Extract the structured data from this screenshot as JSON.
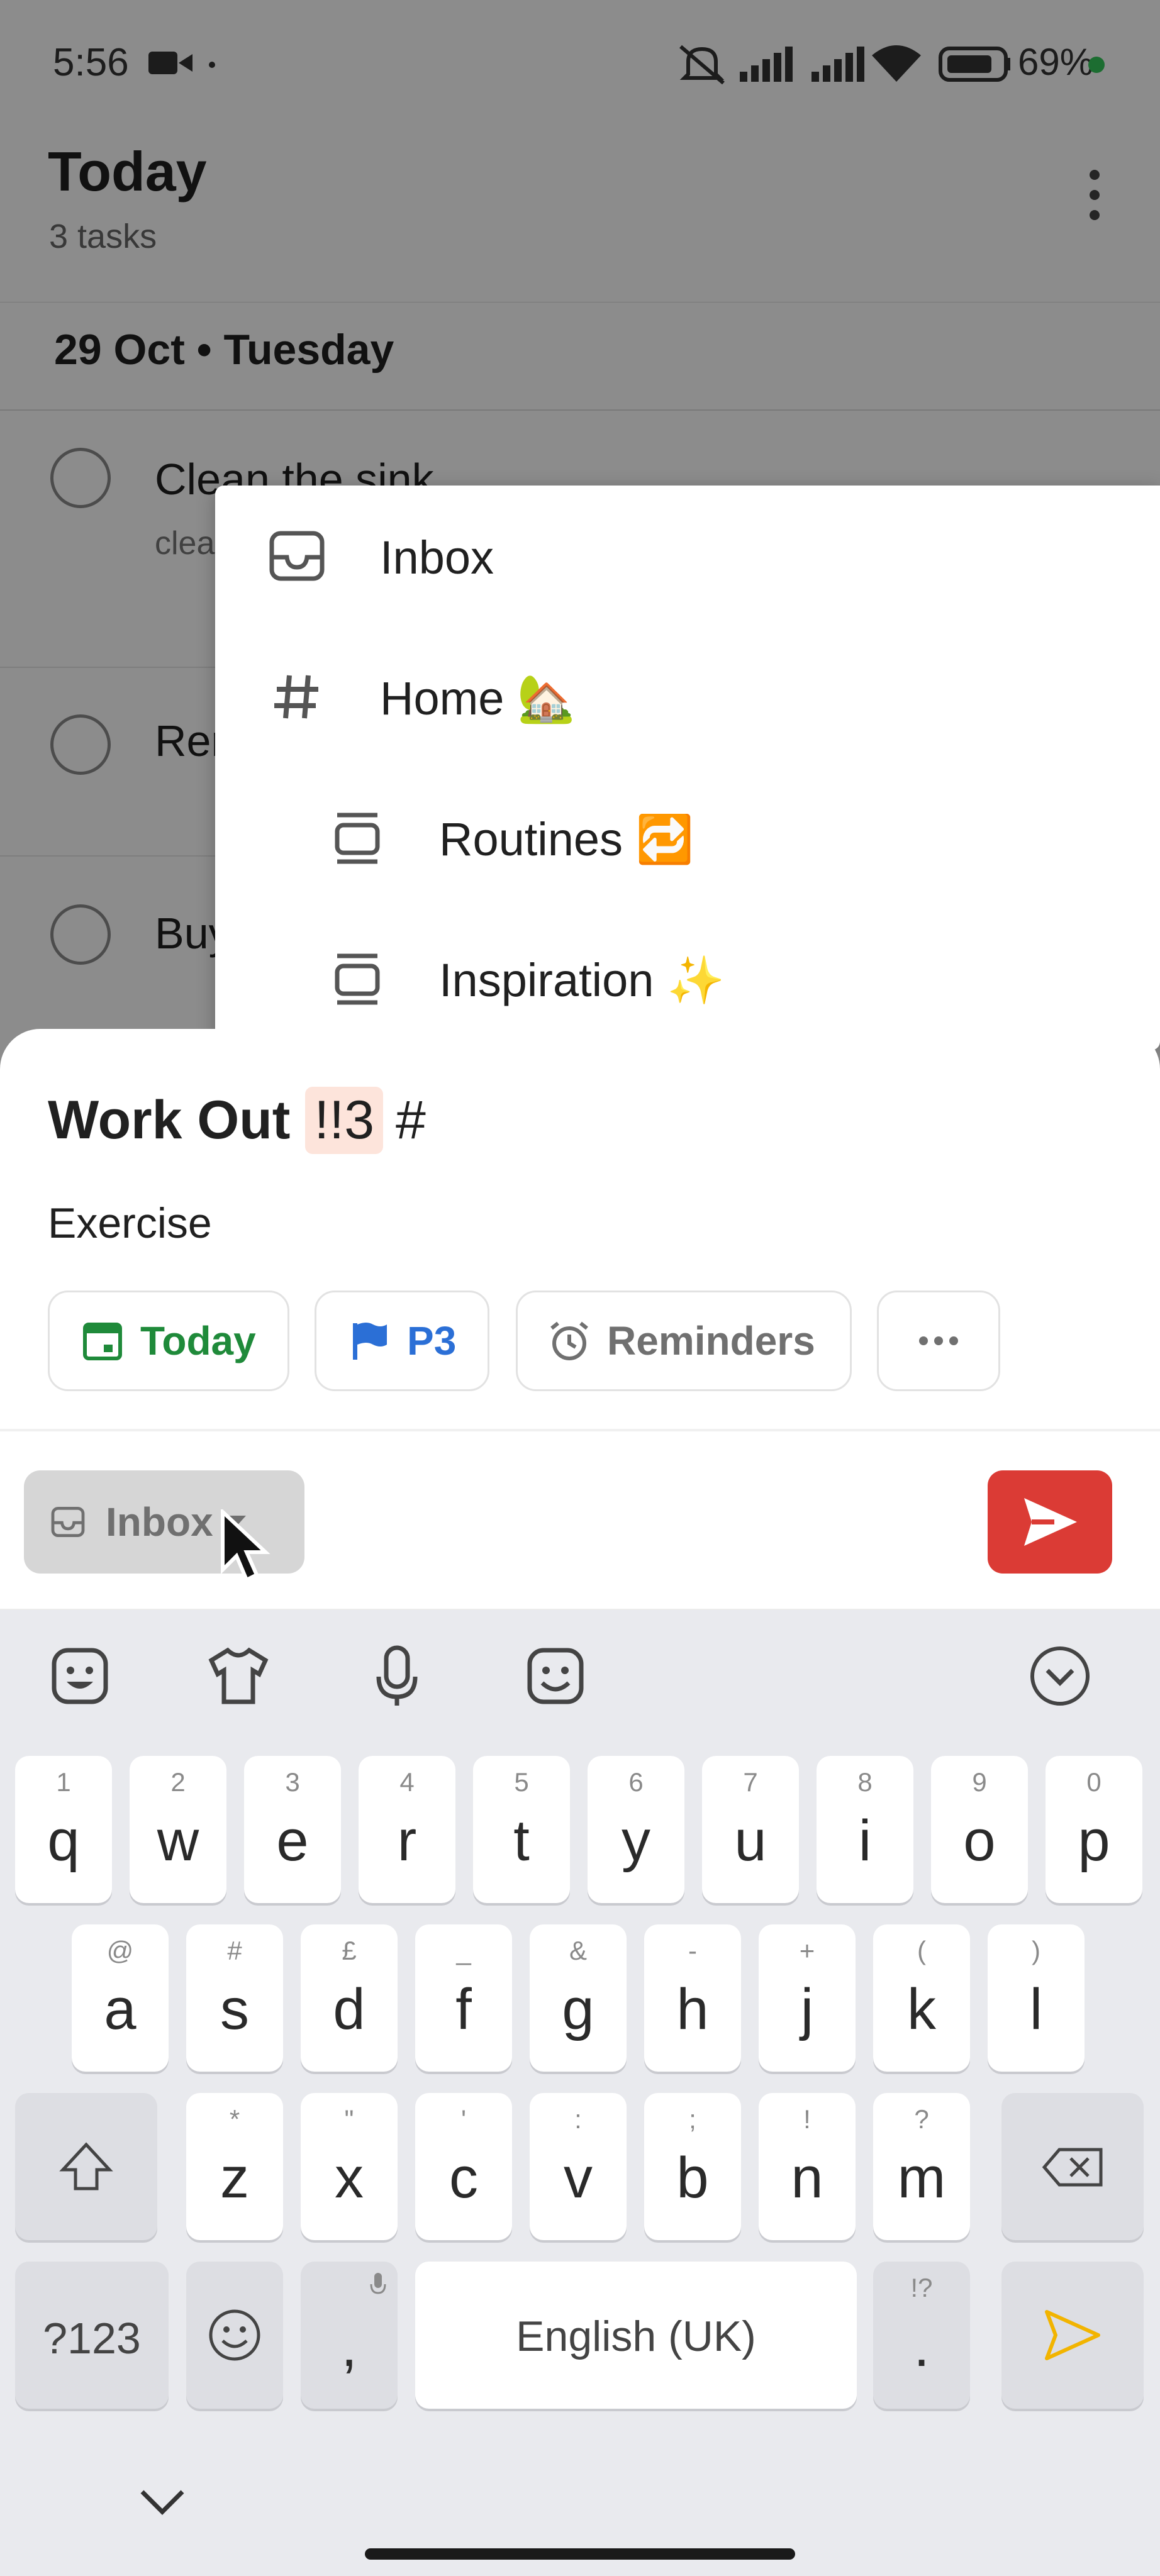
{
  "status_bar": {
    "time": "5:56",
    "battery": "69%"
  },
  "header": {
    "title": "Today",
    "subtitle": "3 tasks"
  },
  "date_section": {
    "label": "29 Oct • Tuesday"
  },
  "tasks": [
    {
      "title": "Clean the sink",
      "description": "clea"
    },
    {
      "title": "Rer"
    },
    {
      "title": "Buy"
    }
  ],
  "dropdown": {
    "items": [
      {
        "label": "Inbox",
        "icon": "inbox-icon"
      },
      {
        "label": "Home 🏡",
        "icon": "hash-icon"
      },
      {
        "label": "Routines 🔁",
        "icon": "section-icon"
      },
      {
        "label": "Inspiration ✨",
        "icon": "section-icon"
      }
    ]
  },
  "quick_add": {
    "task_name": "Work Out",
    "priority_token": "!!3",
    "hash_token": "#",
    "description": "Exercise",
    "chips": [
      {
        "label": "Today",
        "icon": "calendar-icon",
        "color": "#1f8a3a"
      },
      {
        "label": "P3",
        "icon": "flag-icon",
        "color": "#2b6fd6"
      },
      {
        "label": "Reminders",
        "icon": "alarm-icon",
        "color": "#707070"
      },
      {
        "label": "",
        "icon": "more-icon",
        "color": "#707070"
      }
    ],
    "project_button": "Inbox",
    "colors": {
      "accent": "#db3b35",
      "priority_bg": "#fde4db"
    }
  },
  "keyboard": {
    "row1": [
      {
        "key": "q",
        "hint": "1"
      },
      {
        "key": "w",
        "hint": "2"
      },
      {
        "key": "e",
        "hint": "3"
      },
      {
        "key": "r",
        "hint": "4"
      },
      {
        "key": "t",
        "hint": "5"
      },
      {
        "key": "y",
        "hint": "6"
      },
      {
        "key": "u",
        "hint": "7"
      },
      {
        "key": "i",
        "hint": "8"
      },
      {
        "key": "o",
        "hint": "9"
      },
      {
        "key": "p",
        "hint": "0"
      }
    ],
    "row2": [
      {
        "key": "a",
        "hint": "@"
      },
      {
        "key": "s",
        "hint": "#"
      },
      {
        "key": "d",
        "hint": "£"
      },
      {
        "key": "f",
        "hint": "_"
      },
      {
        "key": "g",
        "hint": "&"
      },
      {
        "key": "h",
        "hint": "-"
      },
      {
        "key": "j",
        "hint": "+"
      },
      {
        "key": "k",
        "hint": "("
      },
      {
        "key": "l",
        "hint": ")"
      }
    ],
    "row3": [
      {
        "key": "z",
        "hint": "*"
      },
      {
        "key": "x",
        "hint": "\""
      },
      {
        "key": "c",
        "hint": "'"
      },
      {
        "key": "v",
        "hint": ":"
      },
      {
        "key": "b",
        "hint": ";"
      },
      {
        "key": "n",
        "hint": "!"
      },
      {
        "key": "m",
        "hint": "?"
      }
    ],
    "symbols_key": "?123",
    "comma_key": ",",
    "space_label": "English (UK)",
    "period_key": ".",
    "period_hint": "!?"
  }
}
